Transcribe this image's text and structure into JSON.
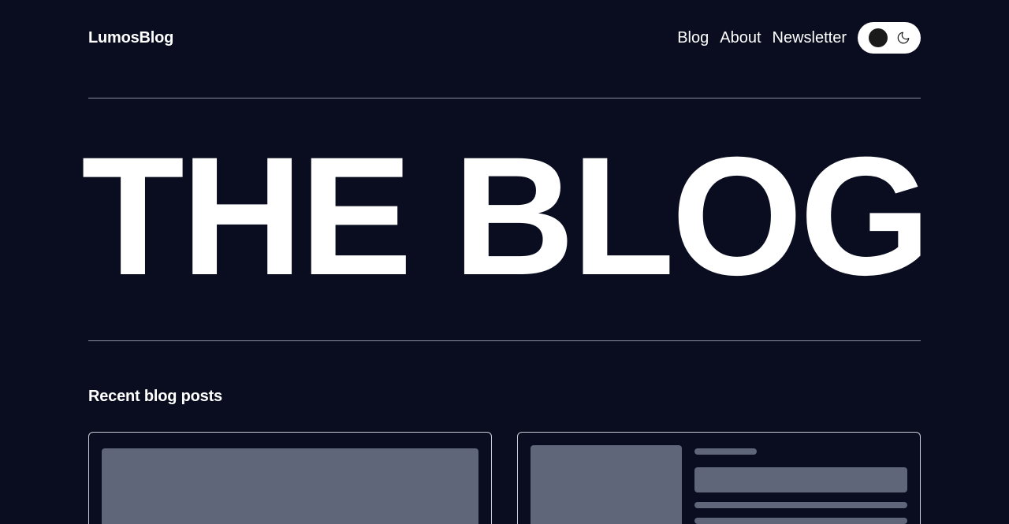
{
  "header": {
    "logo": "LumosBlog",
    "nav": [
      "Blog",
      "About",
      "Newsletter"
    ],
    "theme_toggle": {
      "state": "dark",
      "icon": "moon-icon"
    }
  },
  "hero": {
    "title": "THE BLOG"
  },
  "recent": {
    "heading": "Recent blog posts"
  },
  "colors": {
    "background": "#090d1f",
    "text": "#ffffff",
    "divider": "#8a8fa0",
    "placeholder": "#5f6679",
    "card_border": "#c9ccd6",
    "toggle_bg": "#ffffff",
    "toggle_knob": "#1a1a1a"
  }
}
